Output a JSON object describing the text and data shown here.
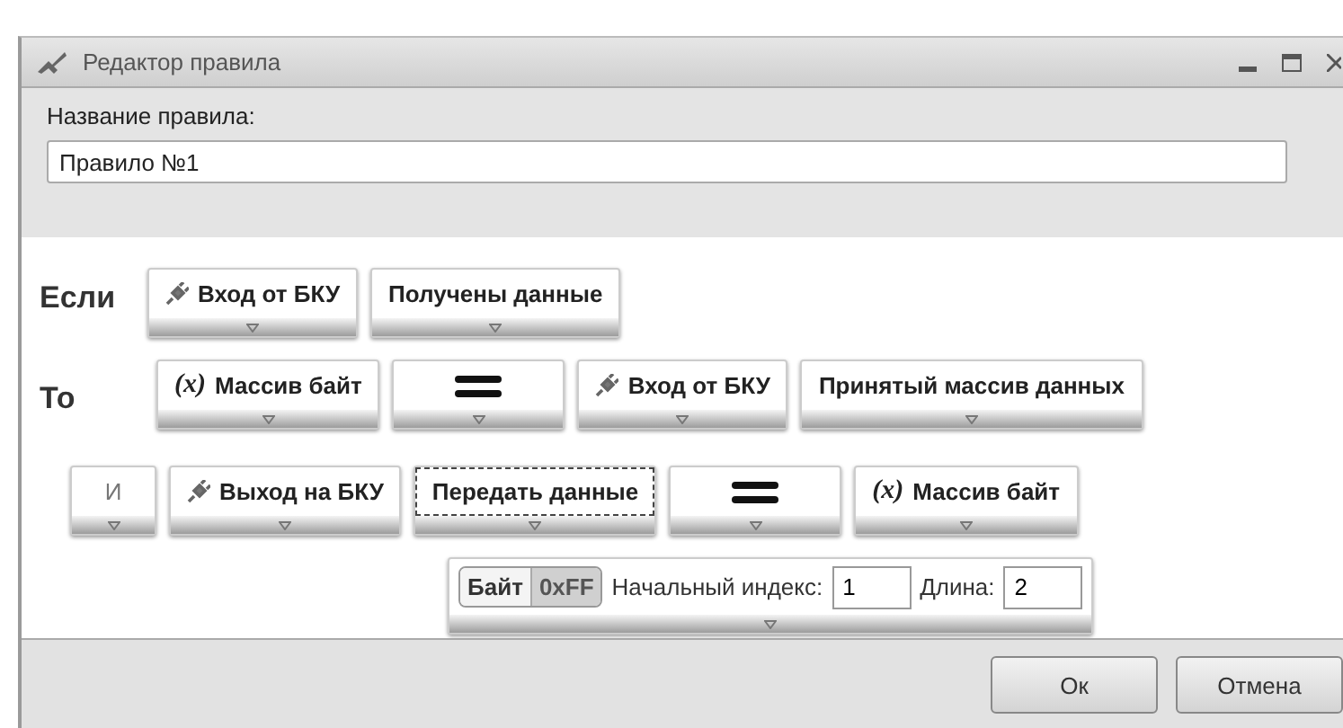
{
  "window": {
    "title": "Редактор правила"
  },
  "rule_name": {
    "label": "Название правила:",
    "value": "Правило №1"
  },
  "rows": [
    {
      "label": "Если",
      "blocks": [
        {
          "kind": "device",
          "text": "Вход от БКУ",
          "focused": false
        },
        {
          "kind": "plain",
          "text": "Получены данные",
          "focused": false
        }
      ]
    },
    {
      "label": "То",
      "blocks": [
        {
          "kind": "variable",
          "prefix": "(x)",
          "text": "Массив байт",
          "focused": false
        },
        {
          "kind": "operator",
          "focused": false
        },
        {
          "kind": "device",
          "text": "Вход от БКУ",
          "focused": false
        },
        {
          "kind": "plain",
          "text": "Принятый массив данных",
          "focused": false
        }
      ]
    },
    {
      "blocks": [
        {
          "kind": "conjunction",
          "text": "И",
          "focused": false
        },
        {
          "kind": "device",
          "text": "Выход на БКУ",
          "focused": false
        },
        {
          "kind": "plain",
          "text": "Передать данные",
          "focused": true
        },
        {
          "kind": "operator",
          "focused": false
        },
        {
          "kind": "variable",
          "prefix": "(x)",
          "text": "Массив байт",
          "focused": false
        }
      ]
    },
    {
      "blocks": [
        {
          "kind": "params",
          "formats": [
            {
              "label": "Байт",
              "selected": true
            },
            {
              "label": "0xFF",
              "selected": false
            }
          ],
          "start_label": "Начальный индекс:",
          "start_value": "1",
          "length_label": "Длина:",
          "length_value": "2",
          "focused": false
        }
      ]
    }
  ],
  "buttons": [
    "Ок",
    "Отмена"
  ]
}
